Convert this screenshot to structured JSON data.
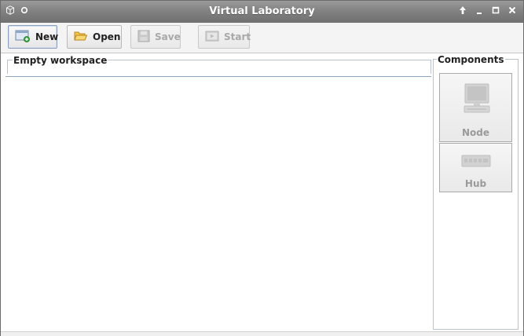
{
  "window": {
    "title": "Virtual Laboratory",
    "controls": [
      "up-arrow-icon",
      "minimize-icon",
      "maximize-icon",
      "close-icon"
    ]
  },
  "toolbar": {
    "new_label": "New",
    "open_label": "Open",
    "save_label": "Save",
    "start_label": "Start"
  },
  "workspace": {
    "title": "Empty workspace"
  },
  "components": {
    "title": "Components",
    "items": [
      {
        "label": "Node",
        "icon": "computer-icon"
      },
      {
        "label": "Hub",
        "icon": "hub-icon"
      }
    ]
  }
}
